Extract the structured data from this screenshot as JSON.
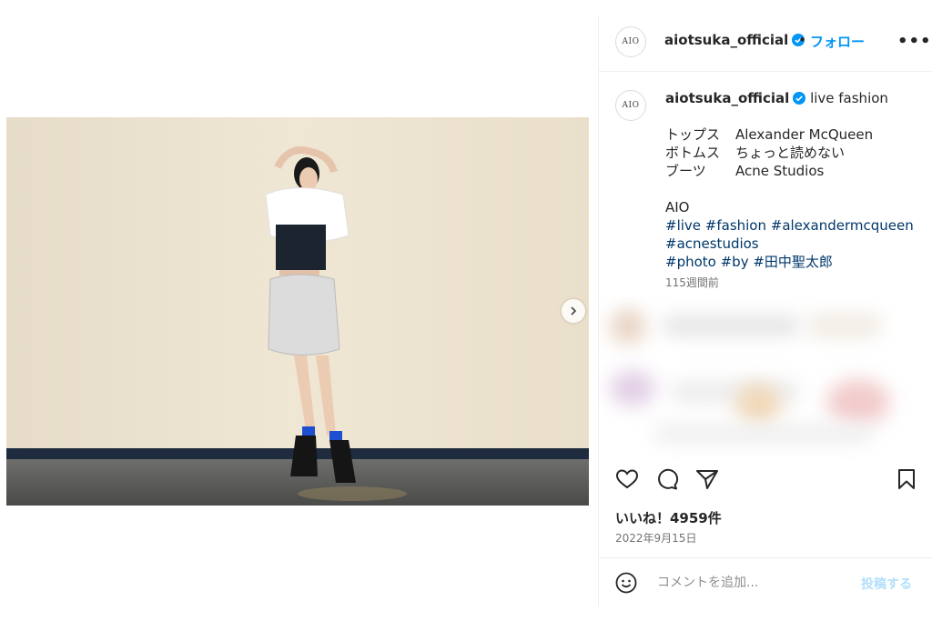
{
  "post": {
    "username": "aiotsuka_official",
    "avatar_text": "AIO",
    "follow_label": "フォロー",
    "more_label": "•••",
    "caption_title": "live fashion",
    "outfit": [
      {
        "label": "トップス",
        "value": "Alexander McQueen"
      },
      {
        "label": "ボトムス",
        "value": "ちょっと読めない"
      },
      {
        "label": "ブーツ",
        "value": "Acne Studios"
      }
    ],
    "signature": "AIO",
    "hashtags_line1": "#live #fashion #alexandermcqueen",
    "hashtags_line2": "#acnestudios",
    "hashtags_line3": "#photo #by #田中聖太郎",
    "time_ago": "115週間前",
    "likes": "いいね！4959件",
    "date": "2022年9月15日",
    "comment_placeholder": "コメントを追加...",
    "post_label": "投稿する"
  },
  "icons": {
    "verified": "verified-badge-icon",
    "next": "chevron-right-icon",
    "like": "heart-icon",
    "comment": "comment-icon",
    "share": "share-icon",
    "save": "bookmark-icon",
    "emoji": "emoji-icon"
  },
  "colors": {
    "accent": "#0095f6",
    "hashtag": "#00376b",
    "muted": "#737373",
    "verified": "#0095f6"
  }
}
